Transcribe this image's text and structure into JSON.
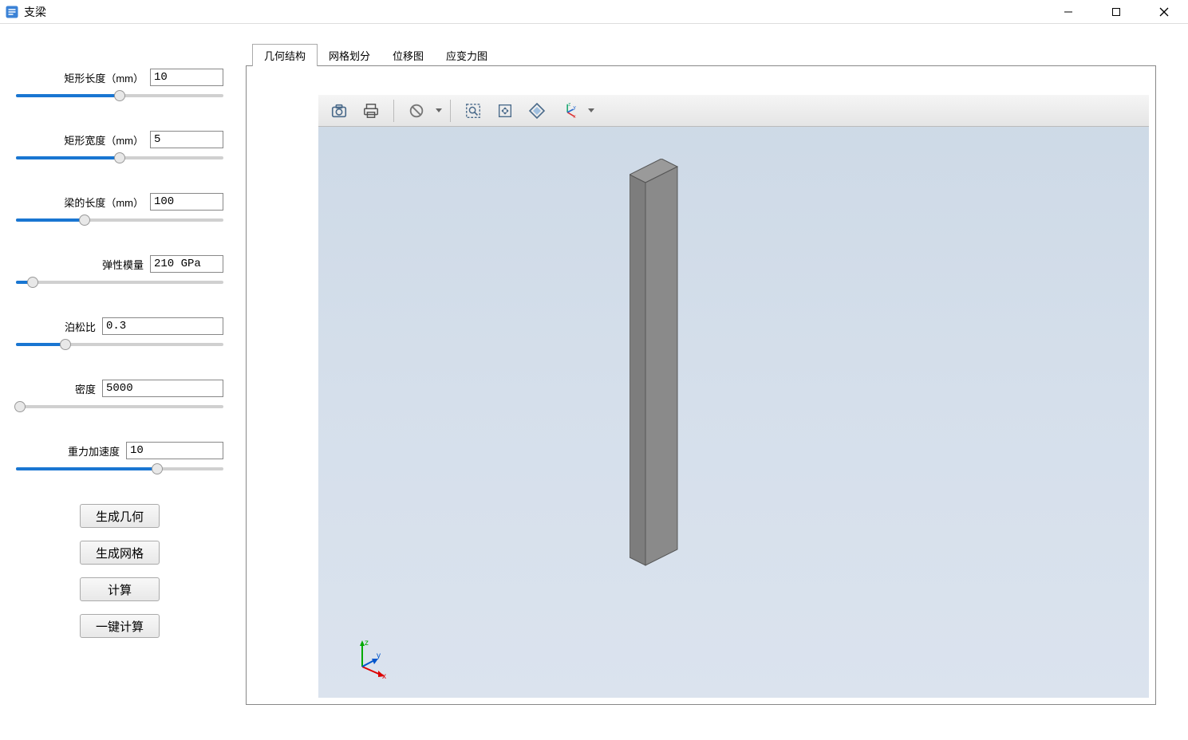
{
  "window": {
    "title": "支梁"
  },
  "params": [
    {
      "label": "矩形长度（mm）",
      "value": "10",
      "slider_pct": 50,
      "input_class": "param-input"
    },
    {
      "label": "矩形宽度（mm）",
      "value": "5",
      "slider_pct": 50,
      "input_class": "param-input"
    },
    {
      "label": "梁的长度（mm）",
      "value": "100",
      "slider_pct": 33,
      "input_class": "param-input"
    },
    {
      "label": "弹性模量",
      "value": "210 GPa",
      "slider_pct": 8,
      "input_class": "param-input"
    },
    {
      "label": "泊松比",
      "value": "0.3",
      "slider_pct": 24,
      "input_class": "param-input wide"
    },
    {
      "label": "密度",
      "value": "5000",
      "slider_pct": 2,
      "input_class": "param-input wide"
    },
    {
      "label": "重力加速度",
      "value": "10",
      "slider_pct": 68,
      "input_class": "param-input full"
    }
  ],
  "buttons": {
    "generate_geometry": "生成几何",
    "generate_mesh": "生成网格",
    "compute": "计算",
    "one_click_compute": "一键计算"
  },
  "tabs": [
    {
      "label": "几何结构",
      "active": true
    },
    {
      "label": "网格划分",
      "active": false
    },
    {
      "label": "位移图",
      "active": false
    },
    {
      "label": "应变力图",
      "active": false
    }
  ],
  "toolbar_icons": [
    "camera-icon",
    "print-icon",
    "sep",
    "forbid-icon",
    "caret",
    "sep",
    "zoom-region-icon",
    "fit-icon",
    "rotate-icon",
    "axis-view-icon",
    "caret"
  ],
  "axis": {
    "x": "x",
    "y": "y",
    "z": "z"
  }
}
